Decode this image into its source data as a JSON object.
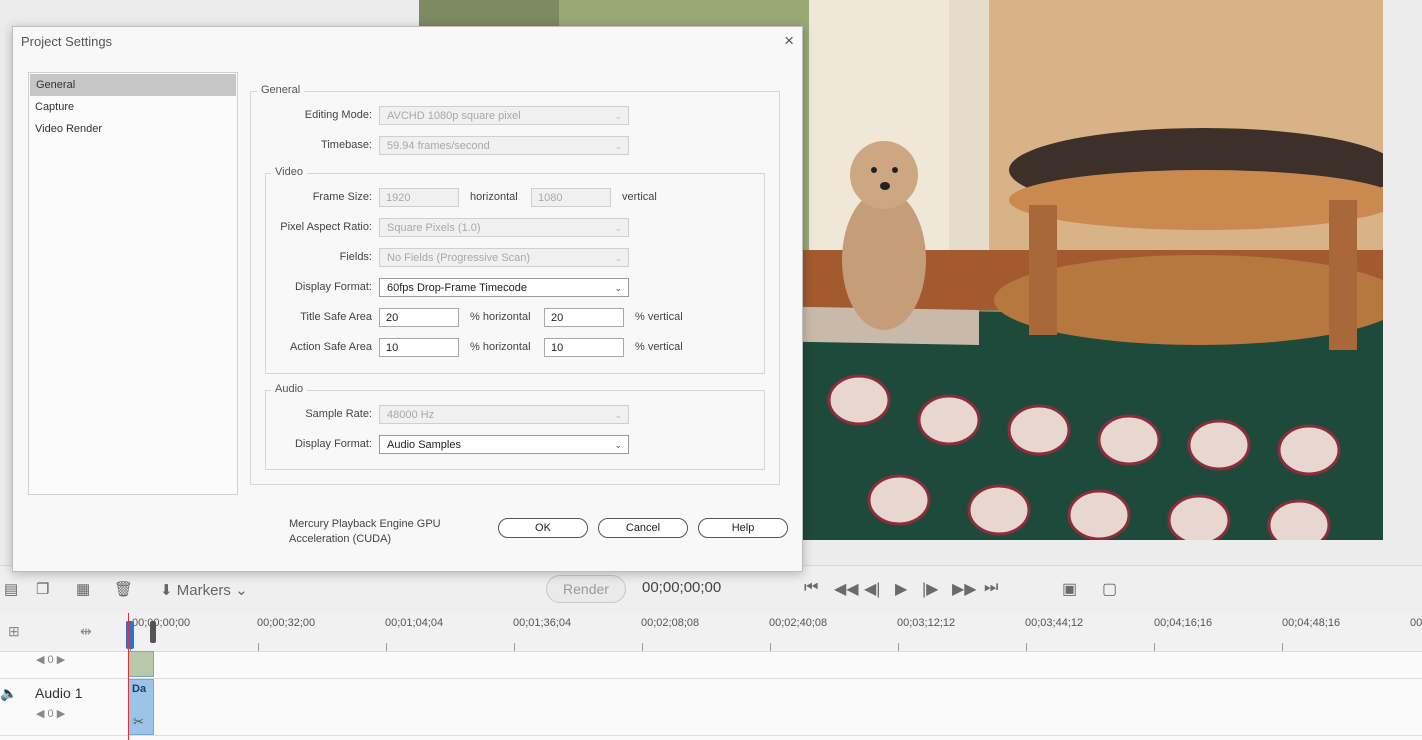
{
  "dialog": {
    "title": "Project Settings",
    "close_glyph": "×",
    "sidebar": [
      {
        "label": "General",
        "selected": true
      },
      {
        "label": "Capture",
        "selected": false
      },
      {
        "label": "Video Render",
        "selected": false
      }
    ],
    "general": {
      "legend": "General",
      "editing_mode_label": "Editing Mode:",
      "editing_mode_value": "AVCHD 1080p square pixel",
      "timebase_label": "Timebase:",
      "timebase_value": "59.94 frames/second"
    },
    "video": {
      "legend": "Video",
      "frame_size_label": "Frame Size:",
      "frame_width": "1920",
      "horizontal_label": "horizontal",
      "frame_height": "1080",
      "vertical_label": "vertical",
      "pixel_aspect_label": "Pixel Aspect Ratio:",
      "pixel_aspect_value": "Square Pixels (1.0)",
      "fields_label": "Fields:",
      "fields_value": "No Fields (Progressive Scan)",
      "display_format_label": "Display Format:",
      "display_format_value": "60fps Drop-Frame Timecode",
      "title_safe_label": "Title Safe Area",
      "title_safe_h": "20",
      "title_safe_v": "20",
      "action_safe_label": "Action Safe Area",
      "action_safe_h": "10",
      "action_safe_v": "10",
      "pct_horizontal": "% horizontal",
      "pct_vertical": "% vertical"
    },
    "audio": {
      "legend": "Audio",
      "sample_rate_label": "Sample Rate:",
      "sample_rate_value": "48000 Hz",
      "display_format_label": "Display Format:",
      "display_format_value": "Audio Samples"
    },
    "gpu_note": "Mercury Playback Engine GPU Acceleration (CUDA)",
    "buttons": {
      "ok": "OK",
      "cancel": "Cancel",
      "help": "Help"
    }
  },
  "transport": {
    "markers_label": "Markers",
    "render_label": "Render",
    "timecode": "00;00;00;00"
  },
  "timeline": {
    "ruler_labels": [
      "00;00;00;00",
      "00;00;32;00",
      "00;01;04;04",
      "00;01;36;04",
      "00;02;08;08",
      "00;02;40;08",
      "00;03;12;12",
      "00;03;44;12",
      "00;04;16;16",
      "00;04;48;16",
      "00"
    ],
    "video_track_value": "0",
    "audio_track_name": "Audio 1",
    "audio_track_value": "0",
    "audio_clip_label": "Da"
  },
  "icons": [
    "close-icon",
    "chevron-down-icon",
    "trash-icon",
    "marker-icon",
    "go-to-start-icon",
    "step-back-icon",
    "play-icon",
    "step-forward-icon",
    "go-to-end-icon",
    "speaker-icon",
    "scissors-icon"
  ]
}
